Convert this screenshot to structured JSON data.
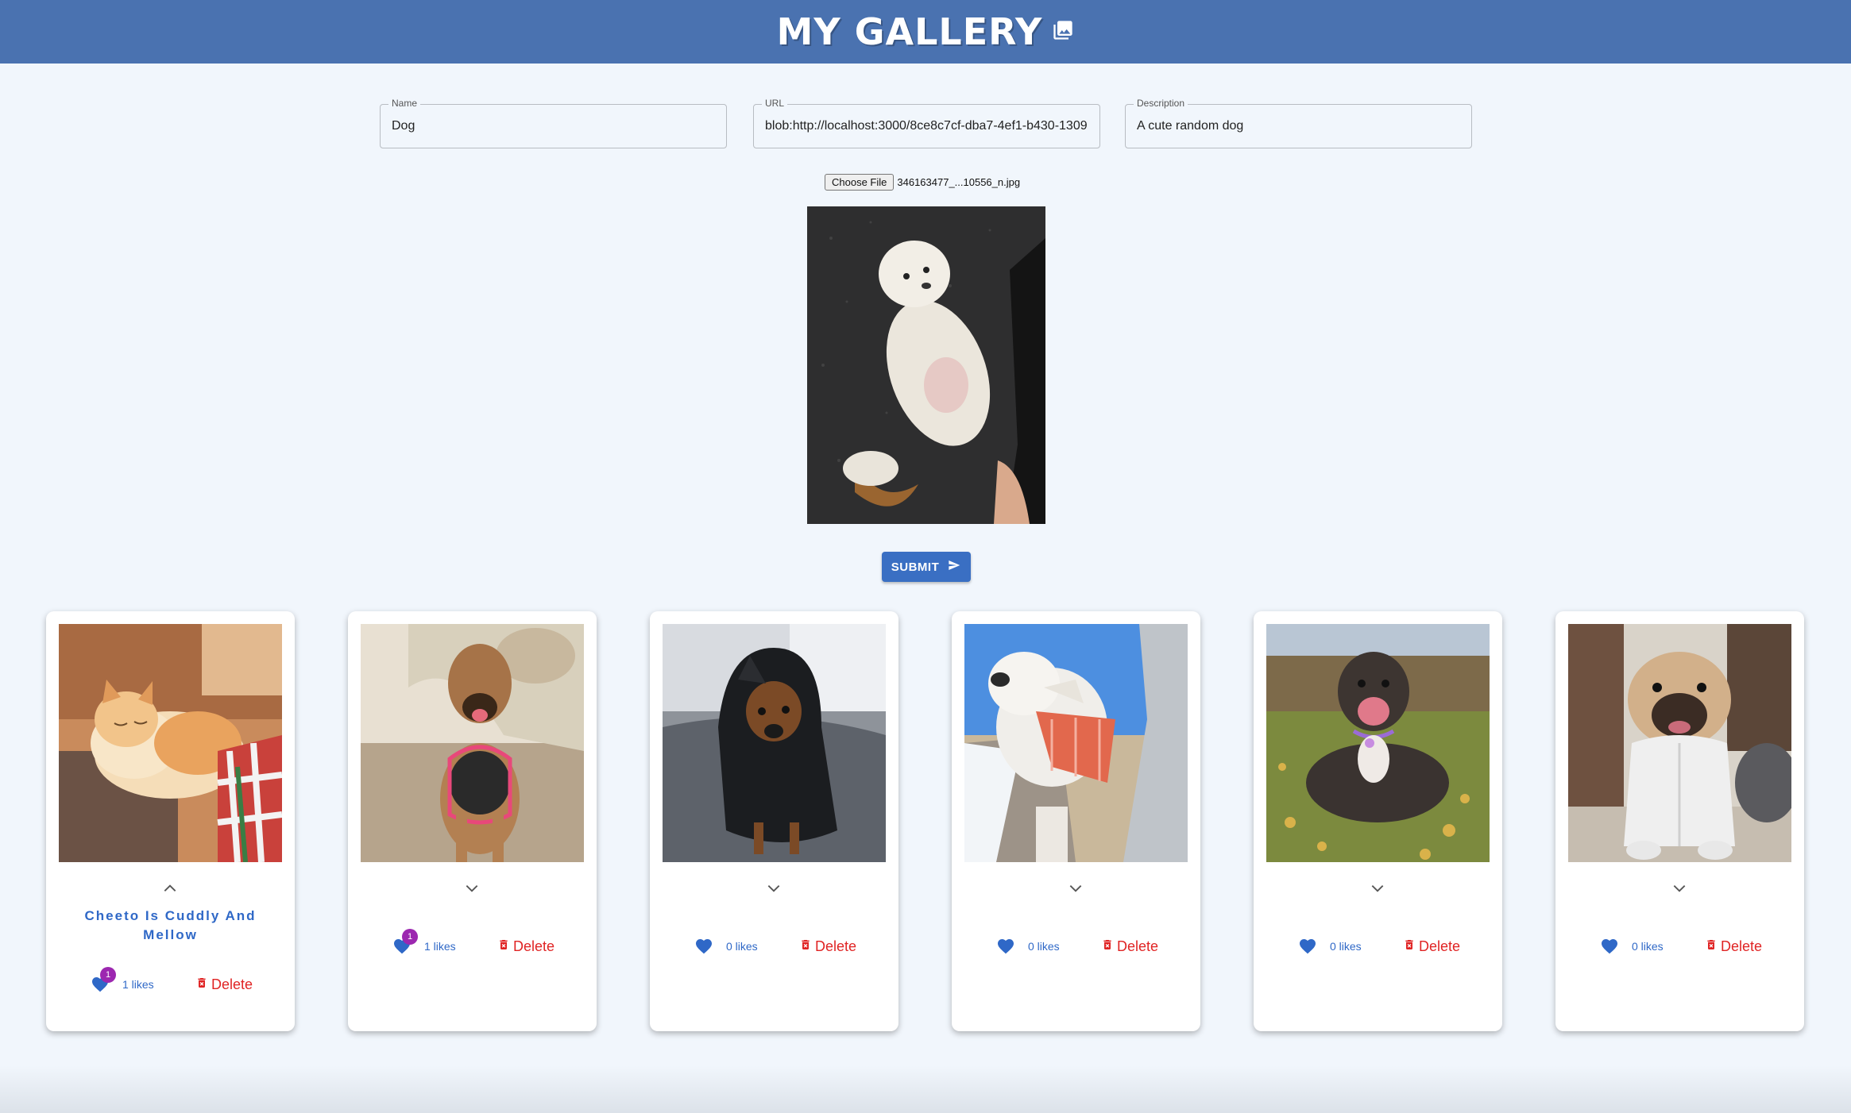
{
  "header": {
    "title": "MY GALLERY",
    "icon": "photo-library-icon",
    "bg": "#4a72b0"
  },
  "form": {
    "name": {
      "label": "Name",
      "value": "Dog"
    },
    "url": {
      "label": "URL",
      "value": "blob:http://localhost:3000/8ce8c7cf-dba7-4ef1-b430-1309"
    },
    "description": {
      "label": "Description",
      "value": "A cute random dog"
    },
    "file": {
      "button": "Choose File",
      "filename": "346163477_...10556_n.jpg"
    },
    "submit": "SUBMIT"
  },
  "cards": [
    {
      "title": "Cheeto Is Cuddly And Mellow",
      "likes": "1 likes",
      "badge": "1",
      "delete": "Delete",
      "expanded": true,
      "image": "orange-white-cat"
    },
    {
      "title": "",
      "likes": "1 likes",
      "badge": "1",
      "delete": "Delete",
      "expanded": false,
      "image": "tan-dog-pink-harness"
    },
    {
      "title": "",
      "likes": "0 likes",
      "badge": "",
      "delete": "Delete",
      "expanded": false,
      "image": "dog-black-raincoat"
    },
    {
      "title": "",
      "likes": "0 likes",
      "badge": "",
      "delete": "Delete",
      "expanded": false,
      "image": "white-dog-car-window"
    },
    {
      "title": "",
      "likes": "0 likes",
      "badge": "",
      "delete": "Delete",
      "expanded": false,
      "image": "dark-dog-on-grass"
    },
    {
      "title": "",
      "likes": "0 likes",
      "badge": "",
      "delete": "Delete",
      "expanded": false,
      "image": "bulldog-white-jacket"
    }
  ],
  "colors": {
    "accent": "#3a6fc3",
    "like": "#2f68c7",
    "delete": "#e02424",
    "badge": "#9c27b0",
    "page_bg": "#f1f6fc"
  }
}
